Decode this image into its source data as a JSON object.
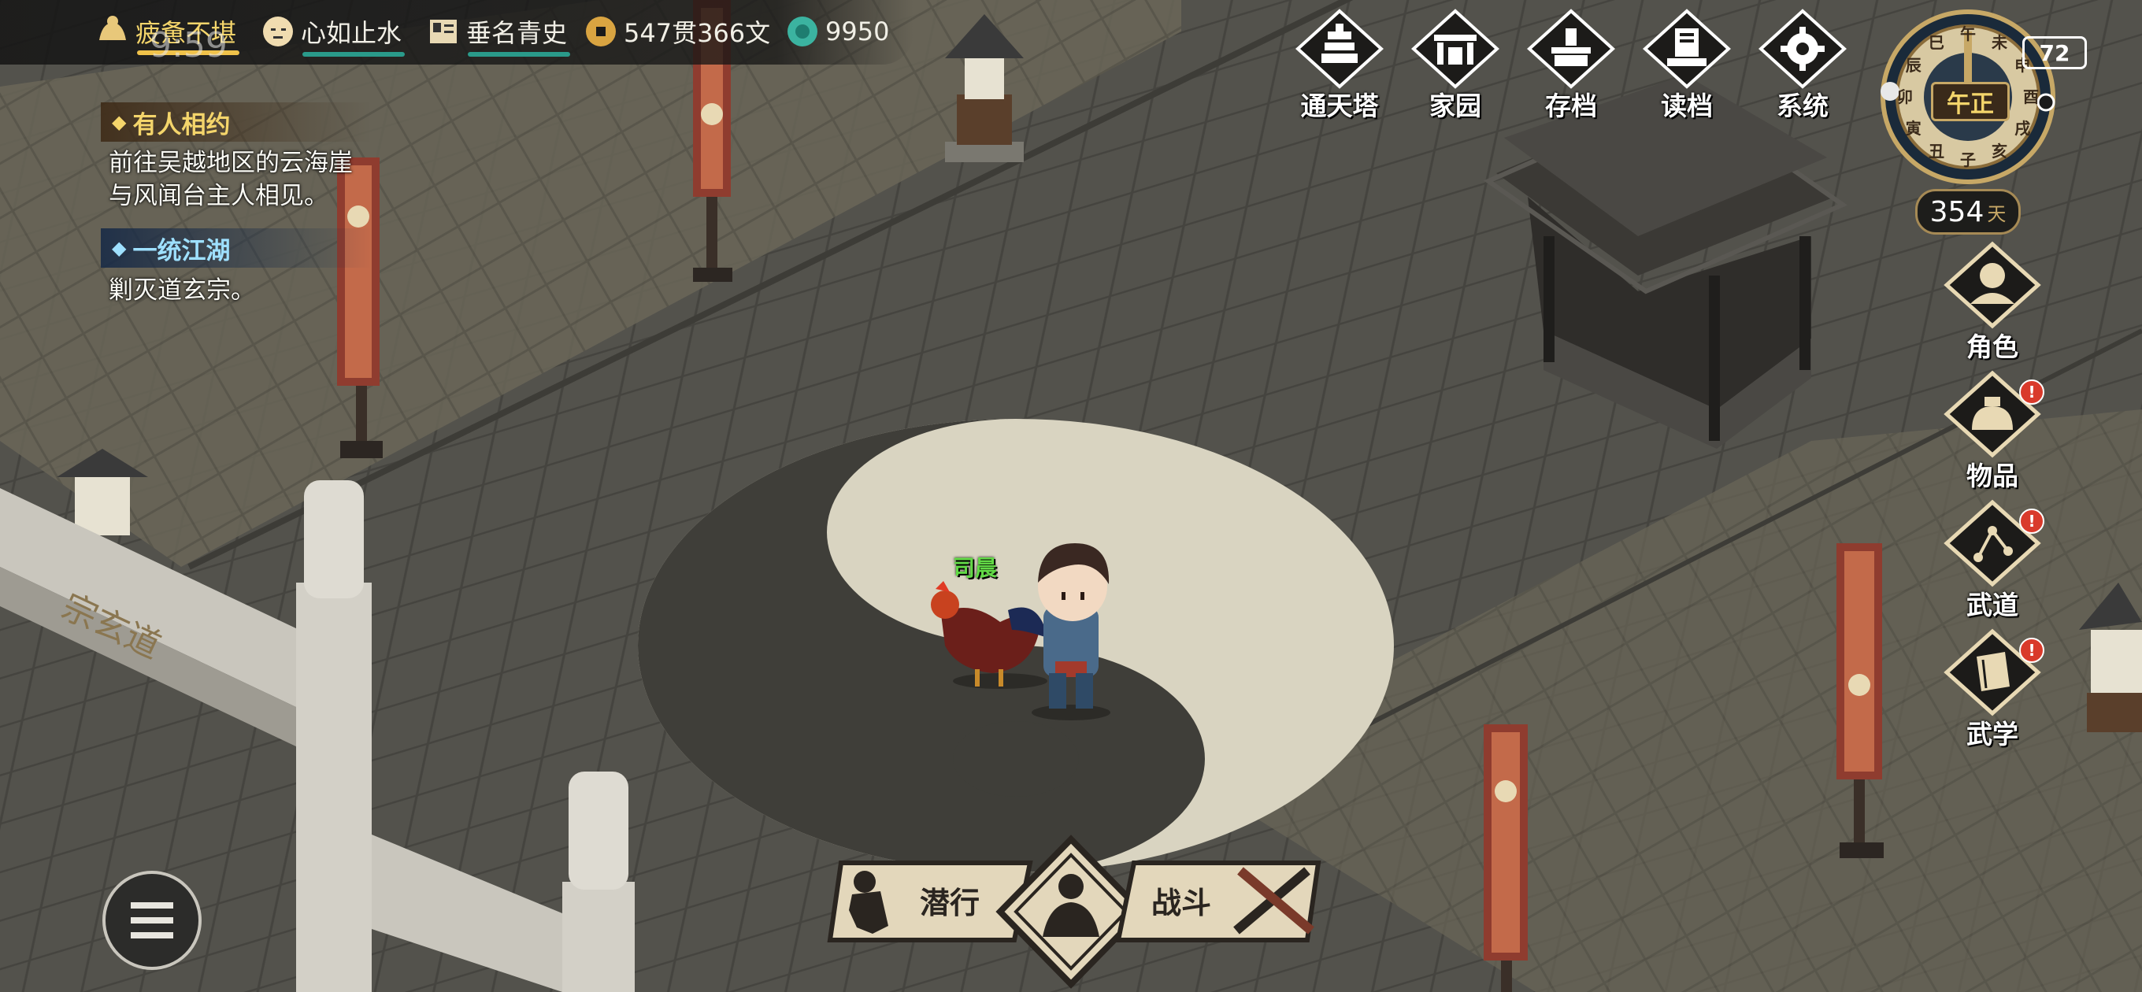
{
  "status": {
    "fatigue": "疲惫不堪",
    "mood": "心如止水",
    "fame": "垂名青史",
    "money": "547贯366文",
    "jade": "9950",
    "clock": "9:59"
  },
  "quests": [
    {
      "title": "有人相约",
      "desc_line1": "前往吴越地区的云海崖",
      "desc_line2": "与风闻台主人相见。"
    },
    {
      "title": "一统江湖",
      "desc_line1": "剿灭道玄宗。"
    }
  ],
  "top_menu": {
    "tower": "通天塔",
    "home": "家园",
    "save": "存档",
    "load": "读档",
    "system": "系统"
  },
  "side_menu": {
    "character": "角色",
    "items": "物品",
    "martial_way": "武道",
    "martial_arts": "武学",
    "alert_mark": "!"
  },
  "time_dial": {
    "period": "午正",
    "branches": [
      "午",
      "未",
      "申",
      "酉",
      "戌",
      "亥",
      "子",
      "丑",
      "寅",
      "卯",
      "辰",
      "巳"
    ]
  },
  "day_counter": {
    "value": "354",
    "unit": "天"
  },
  "battery": "72",
  "npc": {
    "name": "司晨"
  },
  "actions": {
    "sneak": "潜行",
    "fight": "战斗"
  },
  "colors": {
    "ui_gold": "#c7a866",
    "quest1_title": "#f4d56b",
    "quest2_title": "#9ee0ff",
    "npc_name": "#62d946"
  }
}
